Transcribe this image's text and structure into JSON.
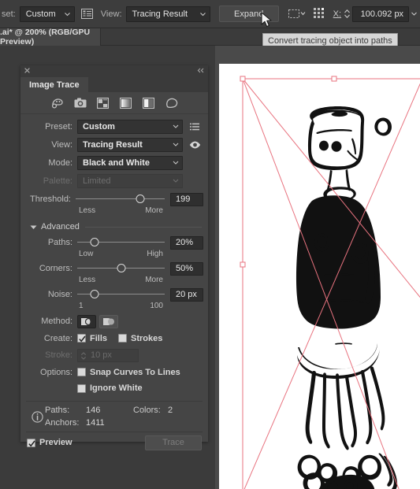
{
  "topbar": {
    "preset_label": "set:",
    "preset_value": "Custom",
    "panel_icon": "image-trace-panel-icon",
    "view_label": "View:",
    "view_value": "Tracing Result",
    "expand_label": "Expand",
    "selection_icon": "selection-bounds-icon",
    "align_icon": "align-grid-icon",
    "x_label": "X:",
    "x_value": "100.092 px"
  },
  "tabbar": {
    "document_title": ".ai* @ 200% (RGB/GPU Preview)",
    "tooltip": "Convert tracing object into paths"
  },
  "panel": {
    "title": "Image Trace",
    "close_icon": "close-icon",
    "collapse_icon": "collapse-icon",
    "preset_icons": [
      "auto-color-icon",
      "high-fidelity-photo-icon",
      "low-fidelity-photo-icon",
      "grayscale-icon",
      "black-and-white-icon",
      "outline-icon"
    ],
    "rows": {
      "preset_label": "Preset:",
      "preset_value": "Custom",
      "preset_menu_icon": "preset-menu-icon",
      "view_label": "View:",
      "view_value": "Tracing Result",
      "view_eye_icon": "eye-icon",
      "mode_label": "Mode:",
      "mode_value": "Black and White",
      "palette_label": "Palette:",
      "palette_value": "Limited"
    },
    "threshold": {
      "label": "Threshold:",
      "value": "199",
      "min_label": "Less",
      "max_label": "More",
      "percent": 73
    },
    "advanced": {
      "label": "Advanced",
      "expanded": true,
      "triangle_icon": "triangle-down-icon"
    },
    "paths": {
      "label": "Paths:",
      "value": "20%",
      "min_label": "Low",
      "max_label": "High",
      "percent": 20
    },
    "corners": {
      "label": "Corners:",
      "value": "50%",
      "min_label": "Less",
      "max_label": "More",
      "percent": 50
    },
    "noise": {
      "label": "Noise:",
      "value": "20 px",
      "min_label": "1",
      "max_label": "100",
      "percent": 20
    },
    "method": {
      "label": "Method:",
      "option_abutting_icon": "method-abutting-icon",
      "option_overlapping_icon": "method-overlapping-icon",
      "selected": "abutting"
    },
    "create": {
      "label": "Create:",
      "fills_label": "Fills",
      "fills_checked": true,
      "strokes_label": "Strokes",
      "strokes_checked": false
    },
    "stroke": {
      "label": "Stroke:",
      "value": "10 px",
      "enabled": false
    },
    "options": {
      "label": "Options:",
      "snap_label": "Snap Curves To Lines",
      "snap_checked": false,
      "ignore_white_label": "Ignore White",
      "ignore_white_checked": false
    },
    "info": {
      "icon": "info-icon",
      "paths_key": "Paths:",
      "paths_value": "146",
      "colors_key": "Colors:",
      "colors_value": "2",
      "anchors_key": "Anchors:",
      "anchors_value": "1411"
    },
    "footer": {
      "preview_label": "Preview",
      "preview_checked": true,
      "trace_label": "Trace",
      "trace_enabled": false
    }
  },
  "canvas": {
    "artwork_name": "robot-character-line-drawing",
    "selection_color": "#e8737f",
    "background": "#ffffff"
  },
  "colors": {
    "panel_bg": "#454545",
    "app_bg": "#3b3b3b",
    "field_bg": "#333333",
    "text": "#e8e8e8",
    "muted_text": "#bdbdbd",
    "disabled_text": "#6e6e6e",
    "selection_pink": "#e8737f"
  }
}
